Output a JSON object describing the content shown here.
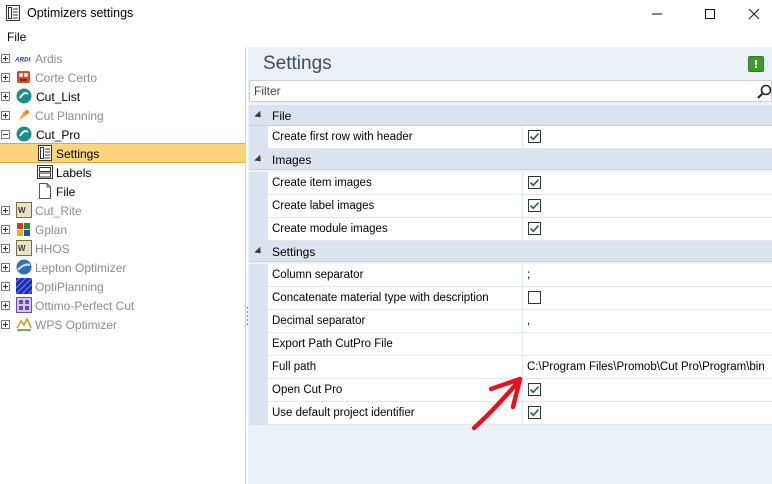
{
  "window": {
    "title": "Optimizers settings",
    "controls": [
      "minimize",
      "maximize",
      "close"
    ]
  },
  "menu": {
    "file": "File"
  },
  "tree": {
    "items": [
      {
        "label": "Ardis",
        "badge": "ARDIS",
        "disabled": true,
        "expander": "plus"
      },
      {
        "label": "Corte Certo",
        "disabled": true,
        "expander": "plus"
      },
      {
        "label": "Cut_List",
        "disabled": false,
        "expander": "plus"
      },
      {
        "label": "Cut Planning",
        "disabled": true,
        "expander": "plus"
      },
      {
        "label": "Cut_Pro",
        "disabled": false,
        "expander": "minus"
      },
      {
        "label": "Settings",
        "disabled": false,
        "selected": true,
        "child": true
      },
      {
        "label": "Labels",
        "disabled": false,
        "child": true
      },
      {
        "label": "File",
        "disabled": false,
        "child": true
      },
      {
        "label": "Cut_Rite",
        "disabled": true,
        "expander": "plus"
      },
      {
        "label": "Gplan",
        "disabled": true,
        "expander": "plus"
      },
      {
        "label": "HHOS",
        "disabled": true,
        "expander": "plus"
      },
      {
        "label": "Lepton Optimizer",
        "disabled": true,
        "expander": "plus"
      },
      {
        "label": "OptiPlanning",
        "disabled": true,
        "expander": "plus"
      },
      {
        "label": "Ottimo-Perfect Cut",
        "disabled": true,
        "expander": "plus"
      },
      {
        "label": "WPS Optimizer",
        "disabled": true,
        "expander": "plus"
      }
    ]
  },
  "settings": {
    "title": "Settings",
    "info_label": "!",
    "filter_placeholder": "Filter",
    "categories": [
      {
        "label": "File",
        "properties": [
          {
            "name": "Create first row with header",
            "type": "checkbox",
            "checked": true
          }
        ]
      },
      {
        "label": "Images",
        "properties": [
          {
            "name": "Create item images",
            "type": "checkbox",
            "checked": true
          },
          {
            "name": "Create label images",
            "type": "checkbox",
            "checked": true
          },
          {
            "name": "Create module images",
            "type": "checkbox",
            "checked": true
          }
        ]
      },
      {
        "label": "Settings",
        "properties": [
          {
            "name": "Column separator",
            "type": "text",
            "value": ";"
          },
          {
            "name": "Concatenate material type with description",
            "type": "checkbox",
            "checked": false
          },
          {
            "name": "Decimal separator",
            "type": "text",
            "value": ","
          },
          {
            "name": "Export Path CutPro File",
            "type": "text",
            "value": ""
          },
          {
            "name": "Full path",
            "type": "text",
            "value": "C:\\Program Files\\Promob\\Cut Pro\\Program\\bin"
          },
          {
            "name": "Open Cut Pro",
            "type": "checkbox",
            "checked": true
          },
          {
            "name": "Use default project identifier",
            "type": "checkbox",
            "checked": true
          }
        ]
      }
    ]
  },
  "colors": {
    "selection": "#fcd47d",
    "category_band": "#dae3ee",
    "annotation_arrow": "#e8101c",
    "checkmark": "#1f6b33"
  }
}
